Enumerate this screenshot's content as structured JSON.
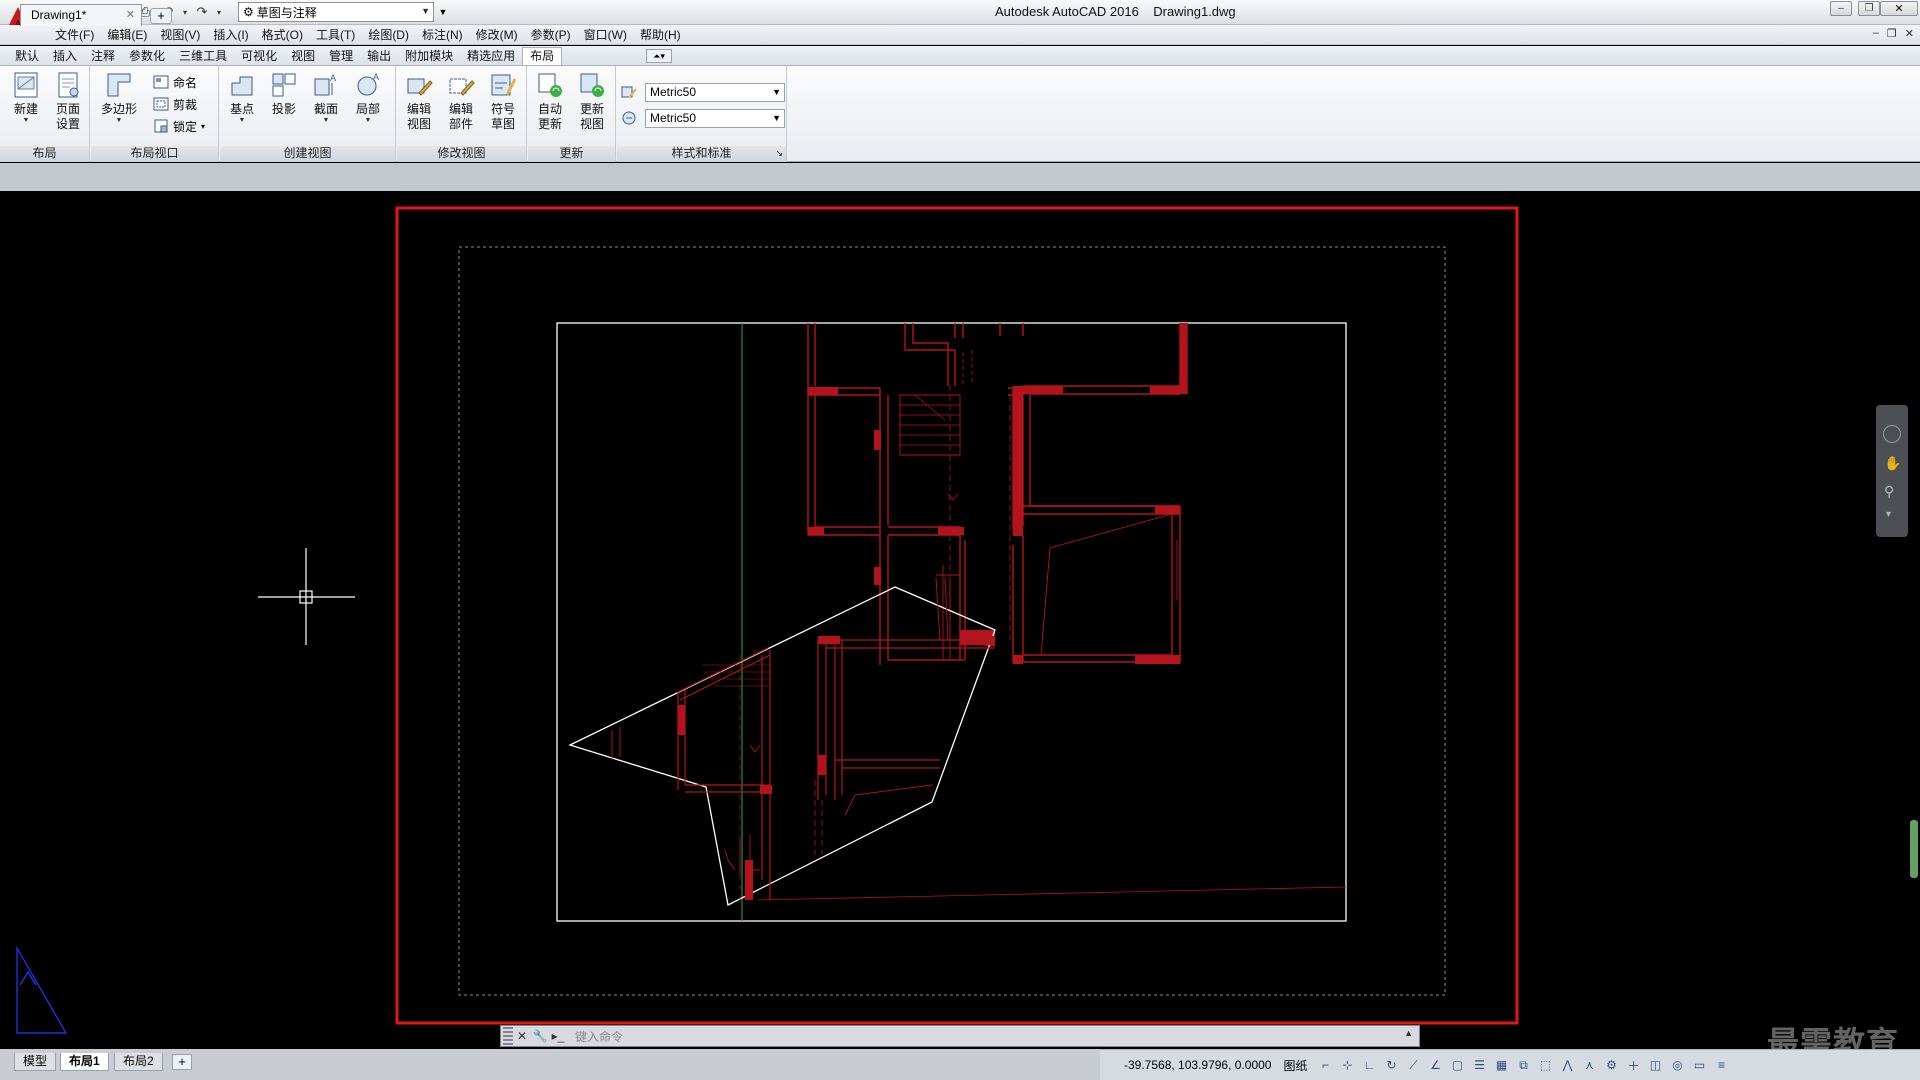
{
  "window": {
    "title": "Autodesk AutoCAD 2016",
    "filename": "Drawing1.dwg"
  },
  "workspace": {
    "selected": "草图与注释"
  },
  "menu": [
    "文件(F)",
    "编辑(E)",
    "视图(V)",
    "插入(I)",
    "格式(O)",
    "工具(T)",
    "绘图(D)",
    "标注(N)",
    "修改(M)",
    "参数(P)",
    "窗口(W)",
    "帮助(H)"
  ],
  "ribbon_tabs": [
    "默认",
    "插入",
    "注释",
    "参数化",
    "三维工具",
    "可视化",
    "视图",
    "管理",
    "输出",
    "附加模块",
    "精选应用",
    "布局"
  ],
  "active_ribbon_tab": "布局",
  "ribbon": {
    "layout_panel": {
      "title": "布局",
      "new_label_1": "新建",
      "page_setup_1": "页面",
      "page_setup_2": "设置"
    },
    "viewport_panel": {
      "title": "布局视口",
      "polygon": "多边形",
      "named": "命名",
      "clip": "剪裁",
      "lock": "锁定"
    },
    "create_view_panel": {
      "title": "创建视图",
      "base": "基点",
      "projected": "投影",
      "section": "截面",
      "detail": "局部"
    },
    "modify_view_panel": {
      "title": "修改视图",
      "edit_view_1": "编辑",
      "edit_view_2": "视图",
      "edit_comp_1": "编辑",
      "edit_comp_2": "部件",
      "symbol_1": "符号",
      "symbol_2": "草图"
    },
    "update_panel": {
      "title": "更新",
      "auto_1": "自动",
      "auto_2": "更新",
      "update_1": "更新",
      "update_2": "视图"
    },
    "styles_panel": {
      "title": "样式和标准",
      "style_1": "Metric50",
      "style_2": "Metric50"
    }
  },
  "file_tab": "Drawing1*",
  "command_prompt": "键入命令",
  "layout_tabs": [
    "模型",
    "布局1",
    "布局2"
  ],
  "active_layout_tab": "布局1",
  "status": {
    "coords": "-39.7568, 103.9796, 0.0000",
    "space": "图纸"
  },
  "watermark": "最需教育",
  "colors": {
    "viewport_border": "#e0161b",
    "drawing_red": "#b3141c",
    "axis_green": "#1f8f2f",
    "canvas_bg": "#000000",
    "ribbon_bg": "#f2f4f7"
  }
}
